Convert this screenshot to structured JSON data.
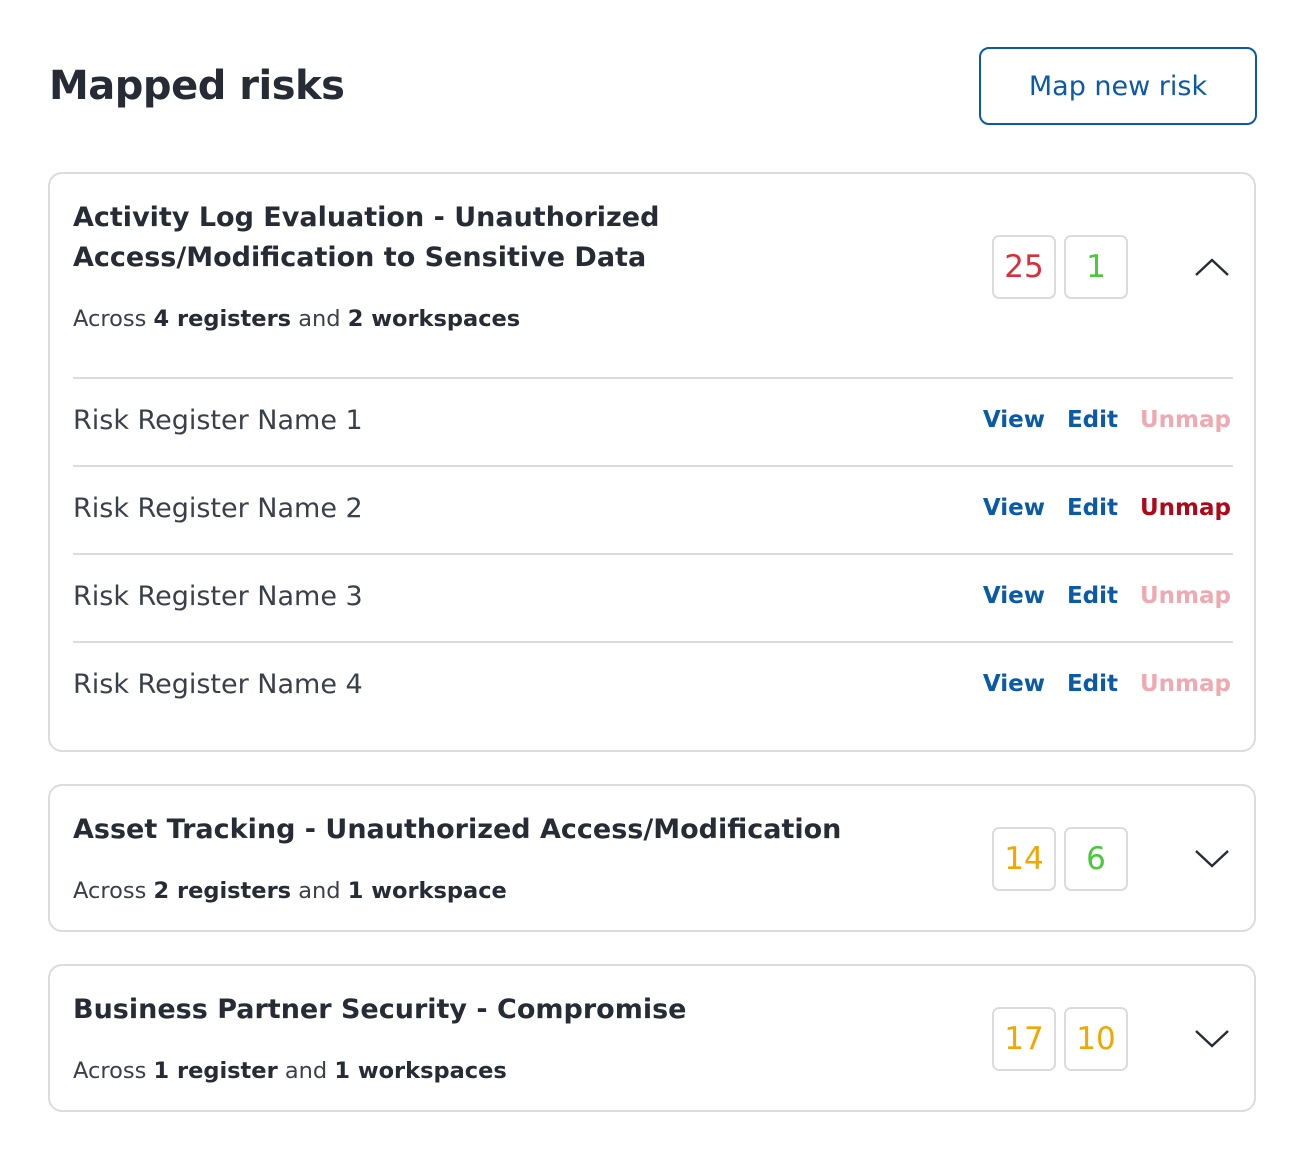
{
  "header": {
    "title": "Mapped risks",
    "map_button_label": "Map new risk"
  },
  "colors": {
    "primary": "#0b5aa6",
    "score_red": "#d8303b",
    "score_green": "#4cc83c",
    "score_orange": "#f2a600",
    "unmap_active": "#b0081b",
    "unmap_inactive": "#eeaab0"
  },
  "risks": [
    {
      "title": "Activity Log Evaluation - Unauthorized Access/Modification to Sensitive Data",
      "sub_prefix": "Across",
      "registers": "4 registers",
      "sub_and": "and",
      "workspaces": "2 workspaces",
      "score_inherent": "25",
      "score_residual": "1",
      "expanded": true,
      "chevron_icon": "chevron-up-icon",
      "registers_list": [
        {
          "name": "Risk Register Name 1",
          "view": "View",
          "edit": "Edit",
          "unmap": "Unmap",
          "unmap_active": false
        },
        {
          "name": "Risk Register Name 2",
          "view": "View",
          "edit": "Edit",
          "unmap": "Unmap",
          "unmap_active": true
        },
        {
          "name": "Risk Register Name 3",
          "view": "View",
          "edit": "Edit",
          "unmap": "Unmap",
          "unmap_active": false
        },
        {
          "name": "Risk Register Name 4",
          "view": "View",
          "edit": "Edit",
          "unmap": "Unmap",
          "unmap_active": false
        }
      ]
    },
    {
      "title": "Asset Tracking - Unauthorized Access/Modification",
      "sub_prefix": "Across",
      "registers": "2 registers",
      "sub_and": "and",
      "workspaces": "1 workspace",
      "score_inherent": "14",
      "score_residual": "6",
      "expanded": false,
      "chevron_icon": "chevron-down-icon"
    },
    {
      "title": "Business Partner Security - Compromise",
      "sub_prefix": "Across",
      "registers": "1 register",
      "sub_and": "and",
      "workspaces": "1 workspaces",
      "score_inherent": "17",
      "score_residual": "10",
      "expanded": false,
      "chevron_icon": "chevron-down-icon"
    }
  ]
}
